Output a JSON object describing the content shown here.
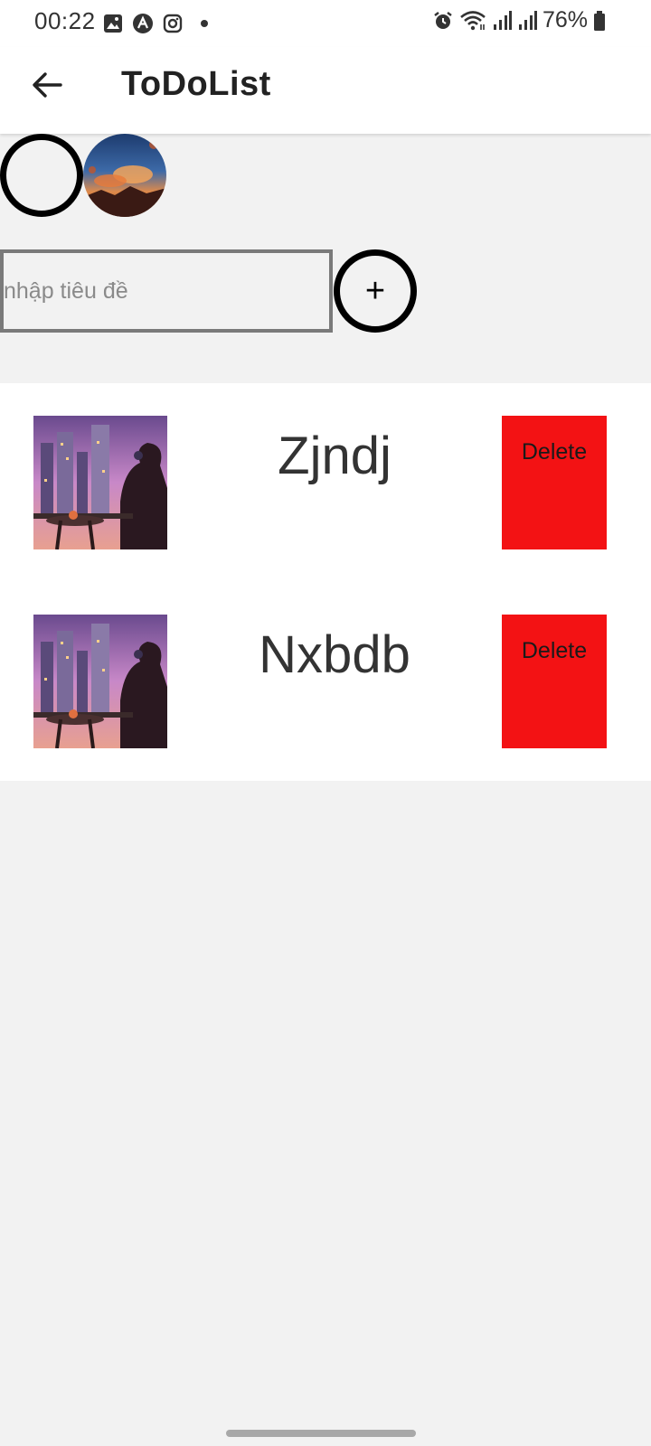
{
  "status_bar": {
    "time": "00:22",
    "battery_text": "76%",
    "left_icons": [
      "gallery-icon",
      "app-a-icon",
      "instagram-icon",
      "dot-icon"
    ],
    "right_icons": [
      "alarm-icon",
      "wifi-icon",
      "signal-icon",
      "signal-icon",
      "battery-icon"
    ]
  },
  "app_bar": {
    "title": "ToDoList",
    "back_icon": "arrow-left-icon"
  },
  "avatars": {
    "empty_icon": "circle-outline-icon",
    "photo_alt": "profile photo"
  },
  "input": {
    "placeholder": "nhập tiêu đề",
    "value": ""
  },
  "add_button": {
    "label": "+"
  },
  "todos": [
    {
      "title": "Zjndj",
      "delete_label": "Delete"
    },
    {
      "title": "Nxbdb",
      "delete_label": "Delete"
    }
  ],
  "colors": {
    "delete_bg": "#f31214",
    "page_bg": "#f2f2f2",
    "card_bg": "#ffffff"
  }
}
